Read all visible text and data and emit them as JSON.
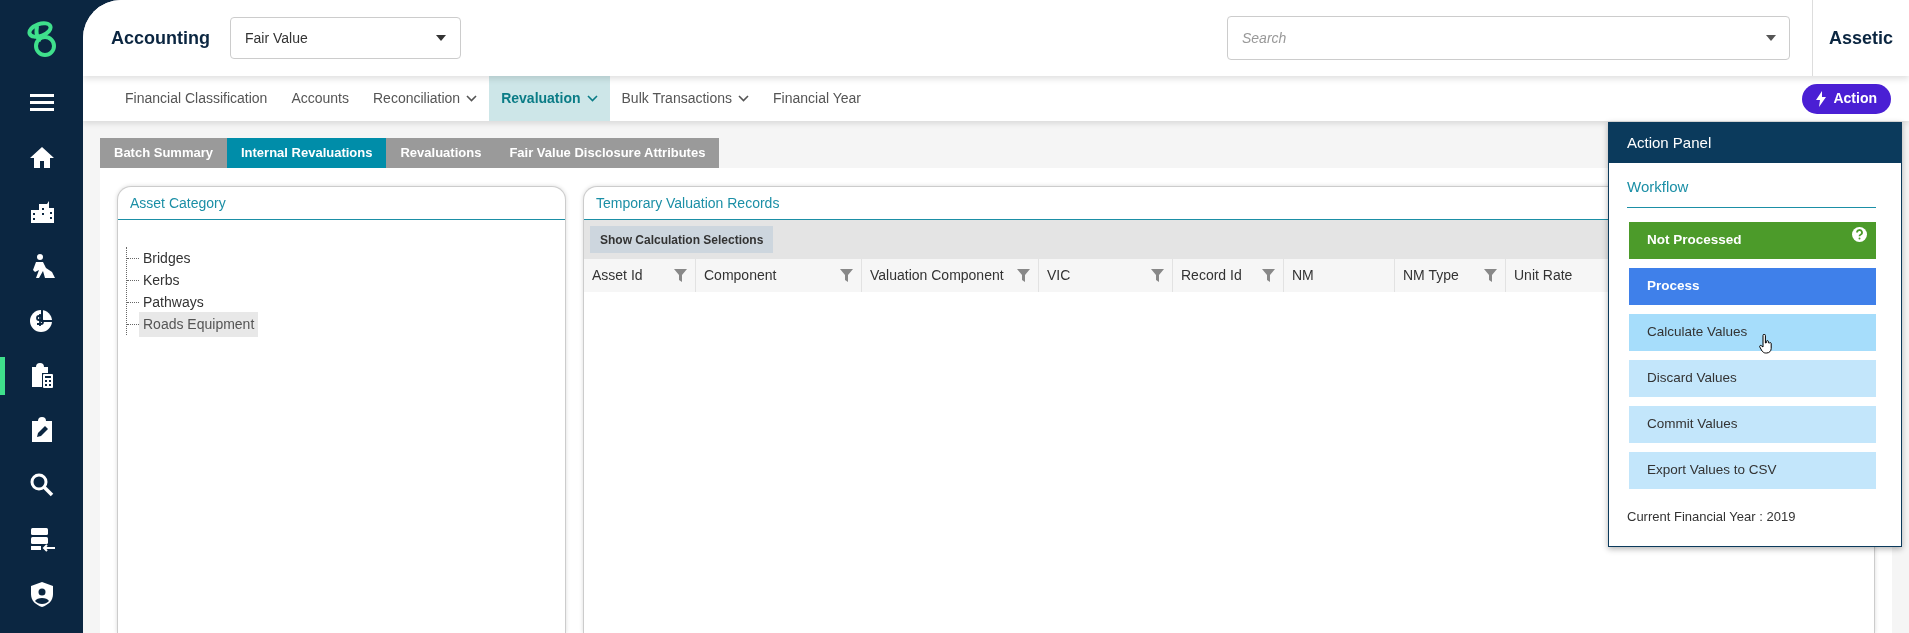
{
  "sidebar": {
    "items": [
      {
        "kind": "menu",
        "selected": false
      },
      {
        "kind": "home",
        "selected": false
      },
      {
        "kind": "buildings",
        "selected": false
      },
      {
        "kind": "worker",
        "selected": false
      },
      {
        "kind": "finance",
        "selected": false
      },
      {
        "kind": "clipboard-calculator",
        "selected": true
      },
      {
        "kind": "clipboard-edit",
        "selected": false
      },
      {
        "kind": "search",
        "selected": false
      },
      {
        "kind": "server-import",
        "selected": false
      },
      {
        "kind": "shield-user",
        "selected": false
      }
    ]
  },
  "header": {
    "title": "Accounting",
    "module_select": {
      "value": "Fair Value"
    },
    "search": {
      "placeholder": "Search"
    },
    "brand": "Assetic"
  },
  "nav": [
    {
      "label": "Financial Classification",
      "dropdown": false,
      "selected": false
    },
    {
      "label": "Accounts",
      "dropdown": false,
      "selected": false
    },
    {
      "label": "Reconciliation",
      "dropdown": true,
      "selected": false
    },
    {
      "label": "Revaluation",
      "dropdown": true,
      "selected": true
    },
    {
      "label": "Bulk Transactions",
      "dropdown": true,
      "selected": false
    },
    {
      "label": "Financial Year",
      "dropdown": false,
      "selected": false
    }
  ],
  "action_button": "Action",
  "tabs": [
    {
      "label": "Batch Summary",
      "selected": false
    },
    {
      "label": "Internal Revaluations",
      "selected": true
    },
    {
      "label": "Revaluations",
      "selected": false
    },
    {
      "label": "Fair Value Disclosure Attributes",
      "selected": false
    }
  ],
  "asset_category": {
    "title": "Asset Category",
    "items": [
      {
        "label": "Bridges",
        "selected": false
      },
      {
        "label": "Kerbs",
        "selected": false
      },
      {
        "label": "Pathways",
        "selected": false
      },
      {
        "label": "Roads Equipment",
        "selected": true
      }
    ]
  },
  "records": {
    "title": "Temporary Valuation Records",
    "toolbar_button": "Show Calculation Selections",
    "columns": [
      {
        "label": "Asset Id",
        "filter": true
      },
      {
        "label": "Component",
        "filter": true
      },
      {
        "label": "Valuation Component",
        "filter": true
      },
      {
        "label": "VIC",
        "filter": true
      },
      {
        "label": "Record Id",
        "filter": true
      },
      {
        "label": "NM",
        "filter": false
      },
      {
        "label": "NM Type",
        "filter": true
      },
      {
        "label": "Unit Rate",
        "filter": false
      }
    ]
  },
  "action_panel": {
    "title": "Action Panel",
    "section": "Workflow",
    "items": [
      {
        "label": "Not Processed",
        "kind": "status",
        "help": true,
        "hovered": false
      },
      {
        "label": "Process",
        "kind": "primary",
        "help": false,
        "hovered": false
      },
      {
        "label": "Calculate Values",
        "kind": "action",
        "help": false,
        "hovered": true
      },
      {
        "label": "Discard Values",
        "kind": "action",
        "help": false,
        "hovered": false
      },
      {
        "label": "Commit Values",
        "kind": "action",
        "help": false,
        "hovered": false
      },
      {
        "label": "Export Values to CSV",
        "kind": "action",
        "help": false,
        "hovered": false
      }
    ],
    "footer": "Current Financial Year : 2019"
  }
}
